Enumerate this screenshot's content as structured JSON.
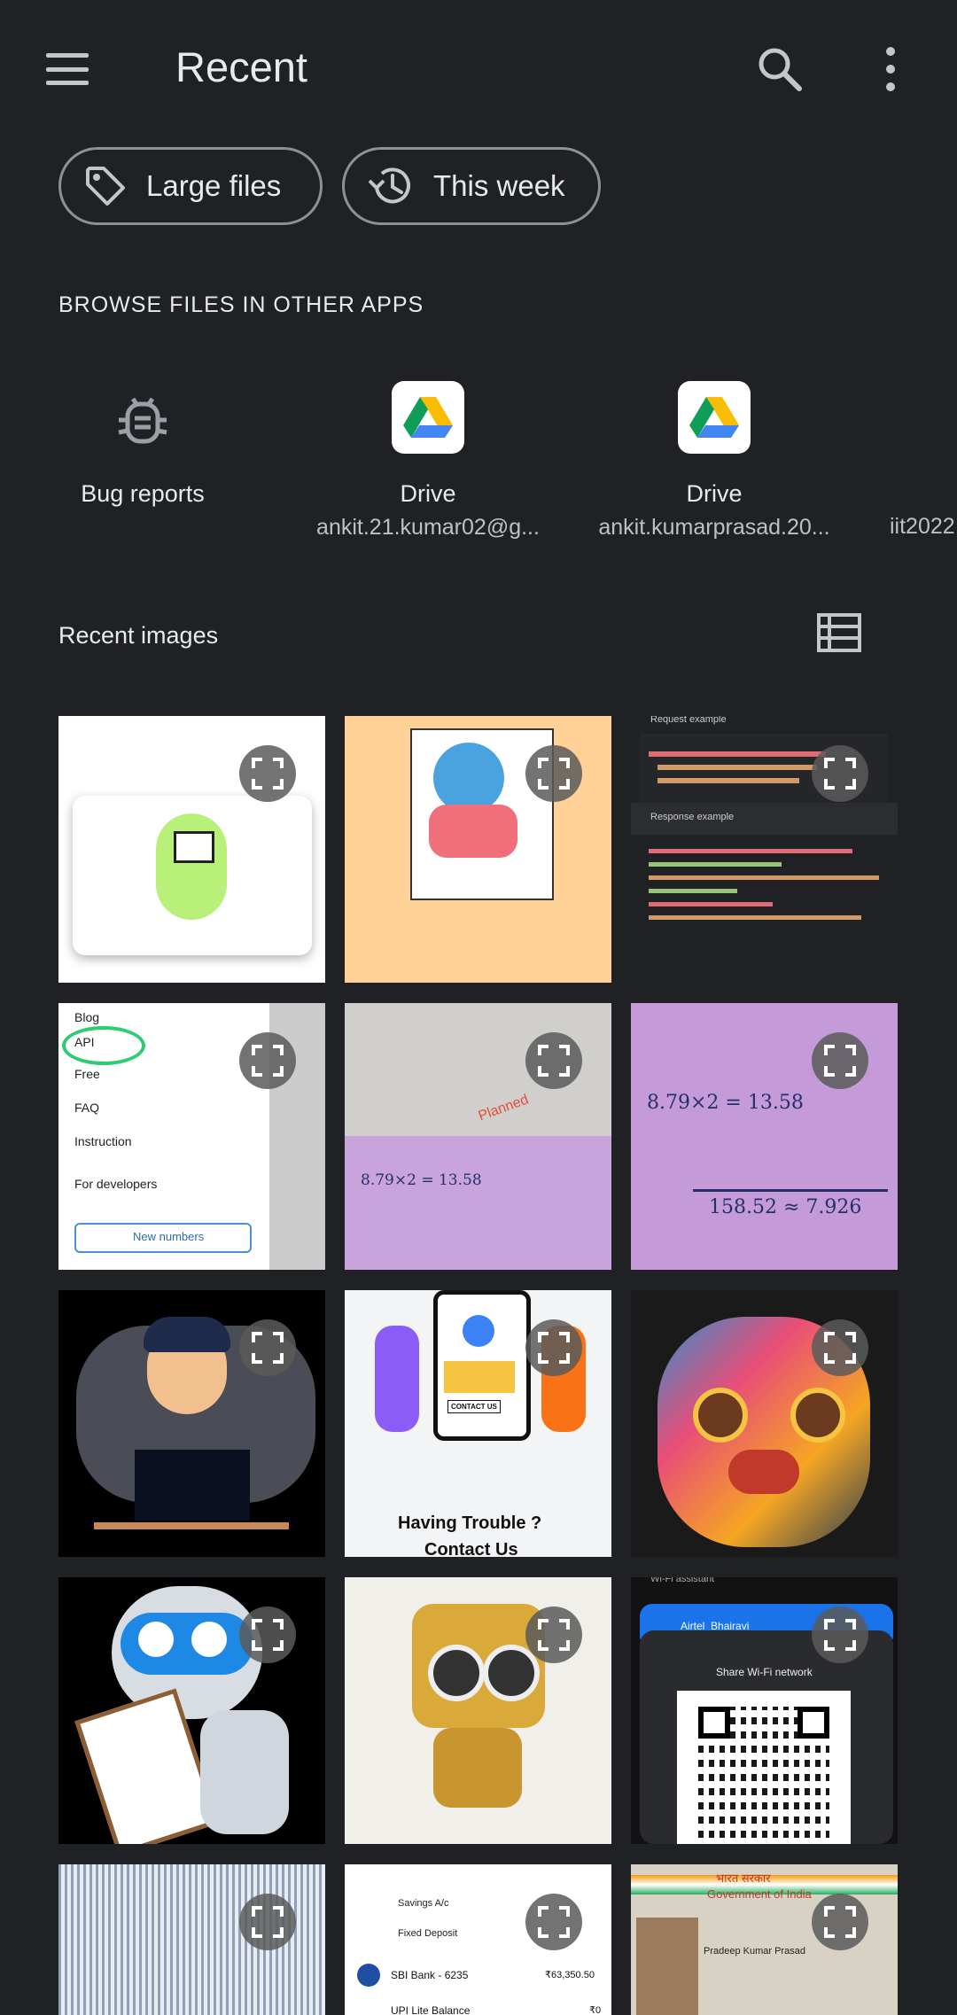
{
  "header": {
    "title": "Recent"
  },
  "chips": [
    {
      "label": "Large files",
      "icon": "tag-icon"
    },
    {
      "label": "This week",
      "icon": "history-icon"
    }
  ],
  "browse": {
    "title": "BROWSE FILES IN OTHER APPS",
    "apps": [
      {
        "name": "Bug reports",
        "sub": "",
        "icon": "bug-icon"
      },
      {
        "name": "Drive",
        "sub": "ankit.21.kumar02@g...",
        "icon": "drive-icon"
      },
      {
        "name": "Drive",
        "sub": "ankit.kumarprasad.20...",
        "icon": "drive-icon"
      },
      {
        "name": "",
        "sub": "iit2022",
        "icon": "drive-icon"
      }
    ]
  },
  "recent_images": {
    "title": "Recent images"
  },
  "thumb_text": {
    "req_example": "Request example",
    "resp_example": "Response example",
    "blog": "Blog",
    "api": "API",
    "free": "Free",
    "faq": "FAQ",
    "instruction": "Instruction",
    "for_dev": "For developers",
    "new_numbers": "New numbers",
    "having_trouble": "Having Trouble ?",
    "contact_us": "Contact Us",
    "contact_btn": "CONTACT US",
    "wifi_assistant": "Wi-Fi assistant",
    "airtel": "Airtel_Bhairavi",
    "share_wifi": "Share Wi-Fi network",
    "savings": "Savings A/c",
    "fixed_deposit": "Fixed Deposit",
    "sbi": "SBI Bank - 6235",
    "sbi_amt": "₹63,350.50",
    "upi": "UPI Lite Balance",
    "upi_amt": "₹0",
    "gov_hindi": "भारत सरकार",
    "gov": "Government of India",
    "name": "Pradeep Kumar Prasad",
    "planned": "Planned",
    "math1": "8.79×2 = 13.58",
    "math2": "158.52 ≈ 7.926"
  }
}
